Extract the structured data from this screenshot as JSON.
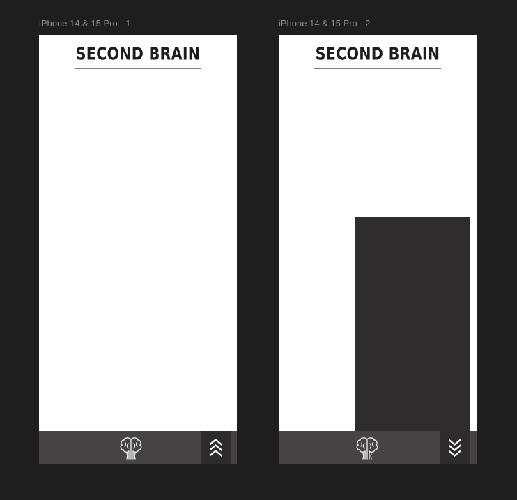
{
  "canvas": {
    "background": "#1e1e1e"
  },
  "frames": [
    {
      "label": "iPhone 14 & 15 Pro - 1",
      "title": "SECOND BRAIN",
      "tab_bar": {
        "brain_icon": "brain-icon",
        "chevron_icon": "chevrons-up-icon"
      }
    },
    {
      "label": "iPhone 14 & 15 Pro - 2",
      "title": "SECOND BRAIN",
      "tab_bar": {
        "brain_icon": "brain-icon",
        "chevron_icon": "chevrons-down-icon"
      }
    }
  ],
  "colors": {
    "tab_bar": "#454344",
    "chevron_box": "#2d2b2c",
    "panel": "#2e2c2d",
    "title": "#1d1d1d"
  }
}
